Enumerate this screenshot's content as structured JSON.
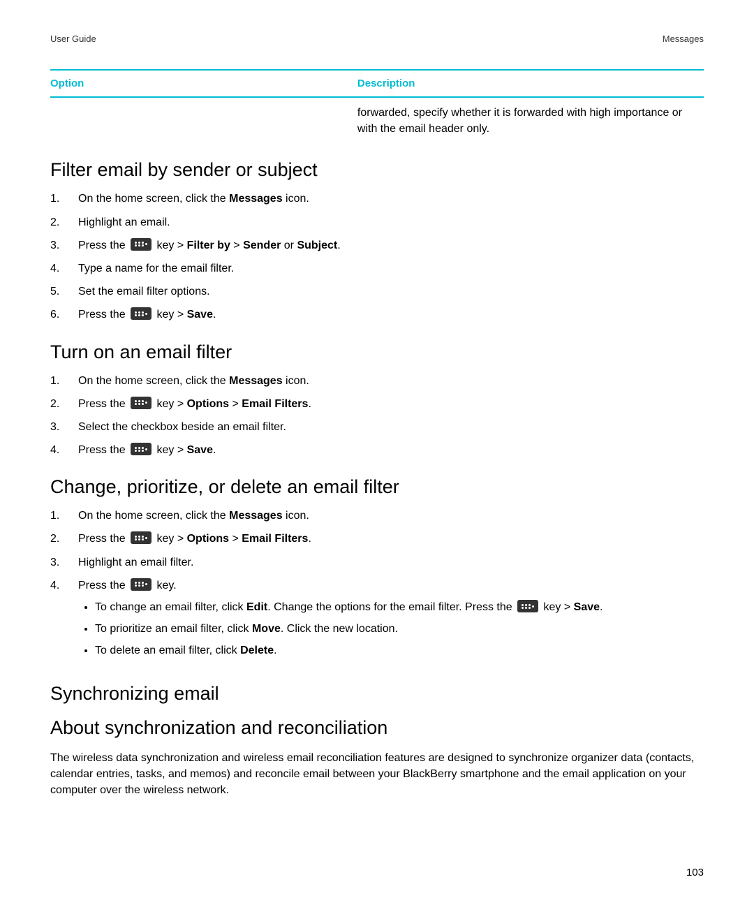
{
  "header": {
    "left": "User Guide",
    "right": "Messages"
  },
  "table": {
    "headers": {
      "option": "Option",
      "description": "Description"
    },
    "row": {
      "option": "",
      "description": "forwarded, specify whether it is forwarded with high importance or with the email header only."
    }
  },
  "sections": {
    "filter": {
      "heading": "Filter email by sender or subject",
      "steps": {
        "s1a": "On the home screen, click the ",
        "s1b": "Messages",
        "s1c": " icon.",
        "s2": "Highlight an email.",
        "s3a": "Press the ",
        "s3b": " key > ",
        "s3c": "Filter by",
        "s3d": " > ",
        "s3e": "Sender",
        "s3f": " or ",
        "s3g": "Subject",
        "s3h": ".",
        "s4": "Type a name for the email filter.",
        "s5": "Set the email filter options.",
        "s6a": "Press the ",
        "s6b": " key > ",
        "s6c": "Save",
        "s6d": "."
      }
    },
    "turnon": {
      "heading": "Turn on an email filter",
      "steps": {
        "s1a": "On the home screen, click the ",
        "s1b": "Messages",
        "s1c": " icon.",
        "s2a": "Press the ",
        "s2b": " key > ",
        "s2c": "Options",
        "s2d": " > ",
        "s2e": "Email Filters",
        "s2f": ".",
        "s3": "Select the checkbox beside an email filter.",
        "s4a": "Press the ",
        "s4b": " key > ",
        "s4c": "Save",
        "s4d": "."
      }
    },
    "change": {
      "heading": "Change, prioritize, or delete an email filter",
      "steps": {
        "s1a": "On the home screen, click the ",
        "s1b": "Messages",
        "s1c": " icon.",
        "s2a": "Press the ",
        "s2b": " key > ",
        "s2c": "Options",
        "s2d": " > ",
        "s2e": "Email Filters",
        "s2f": ".",
        "s3": "Highlight an email filter.",
        "s4a": "Press the ",
        "s4b": " key.",
        "b1a": "To change an email filter, click ",
        "b1b": "Edit",
        "b1c": ". Change the options for the email filter. Press the ",
        "b1d": " key > ",
        "b1e": "Save",
        "b1f": ".",
        "b2a": "To prioritize an email filter, click ",
        "b2b": "Move",
        "b2c": ". Click the new location.",
        "b3a": "To delete an email filter, click ",
        "b3b": "Delete",
        "b3c": "."
      }
    },
    "sync": {
      "heading": "Synchronizing email",
      "about_heading": "About synchronization and reconciliation",
      "body": "The wireless data synchronization and wireless email reconciliation features are designed to synchronize organizer data (contacts, calendar entries, tasks, and memos) and reconcile email between your BlackBerry smartphone and the email application on your computer over the wireless network."
    }
  },
  "page_number": "103"
}
